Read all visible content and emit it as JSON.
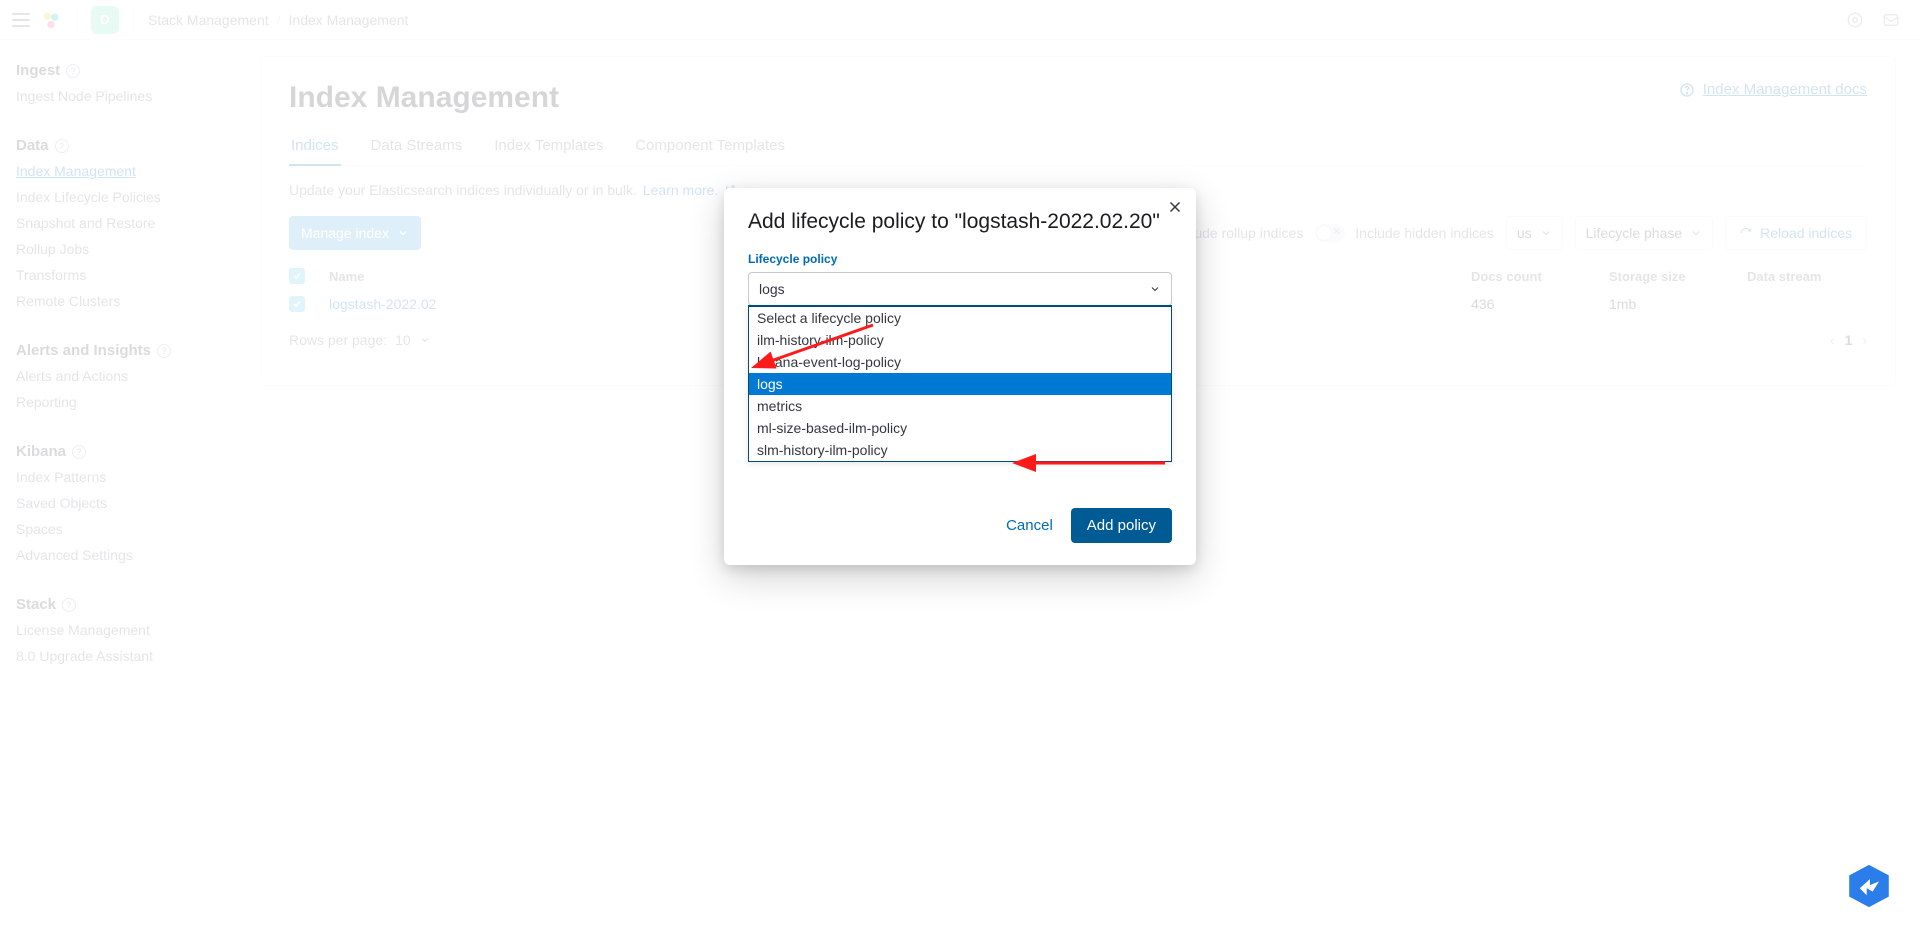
{
  "header": {
    "space_initial": "D",
    "breadcrumb": [
      "Stack Management",
      "Index Management"
    ]
  },
  "sidebar": {
    "groups": [
      {
        "title": "Ingest",
        "items": [
          "Ingest Node Pipelines"
        ]
      },
      {
        "title": "Data",
        "items": [
          "Index Management",
          "Index Lifecycle Policies",
          "Snapshot and Restore",
          "Rollup Jobs",
          "Transforms",
          "Remote Clusters"
        ],
        "active": "Index Management"
      },
      {
        "title": "Alerts and Insights",
        "items": [
          "Alerts and Actions",
          "Reporting"
        ]
      },
      {
        "title": "Kibana",
        "items": [
          "Index Patterns",
          "Saved Objects",
          "Spaces",
          "Advanced Settings"
        ]
      },
      {
        "title": "Stack",
        "items": [
          "License Management",
          "8.0 Upgrade Assistant"
        ]
      }
    ]
  },
  "page": {
    "title": "Index Management",
    "docs_link": "Index Management docs",
    "tabs": [
      "Indices",
      "Data Streams",
      "Index Templates",
      "Component Templates"
    ],
    "active_tab": "Indices",
    "subtext_prefix": "Update your Elasticsearch indices individually or in bulk.",
    "learn_more": "Learn more.",
    "manage_button": "Manage index",
    "toggle_rollup": "Include rollup indices",
    "toggle_hidden": "Include hidden indices",
    "filter_status": "us",
    "filter_phase": "Lifecycle phase",
    "reload": "Reload indices",
    "columns": {
      "name": "Name",
      "docs": "Docs count",
      "storage": "Storage size",
      "stream": "Data stream"
    },
    "row": {
      "name": "logstash-2022.02",
      "docs": "436",
      "storage": "1mb",
      "stream": ""
    },
    "rows_per_page_label": "Rows per page:",
    "rows_per_page_value": "10",
    "current_page": "1"
  },
  "modal": {
    "title": "Add lifecycle policy to \"logstash-2022.02.20\"",
    "field_label": "Lifecycle policy",
    "selected": "logs",
    "options": [
      "Select a lifecycle policy",
      "ilm-history-ilm-policy",
      "kibana-event-log-policy",
      "logs",
      "metrics",
      "ml-size-based-ilm-policy",
      "slm-history-ilm-policy"
    ],
    "selected_index": 3,
    "cancel": "Cancel",
    "add": "Add policy"
  }
}
